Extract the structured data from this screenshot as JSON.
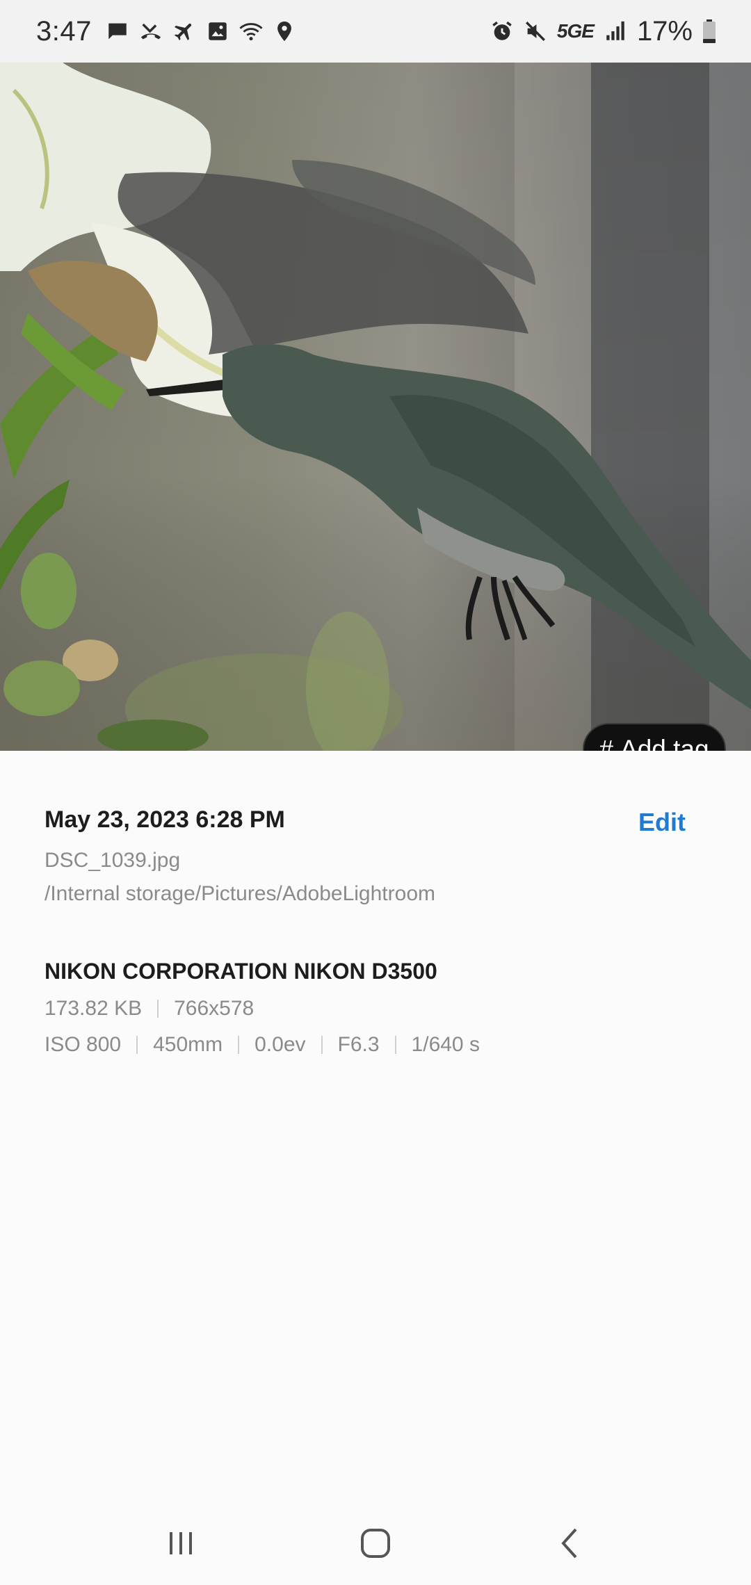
{
  "status_bar": {
    "time": "3:47",
    "network_type": "5GE",
    "battery_level": "17%"
  },
  "photo": {
    "add_tag_hash": "#",
    "add_tag_label": "Add tag"
  },
  "details": {
    "date_time": "May 23, 2023 6:28 PM",
    "edit_label": "Edit",
    "file_name": "DSC_1039.jpg",
    "file_path": "/Internal storage/Pictures/AdobeLightroom",
    "camera": "NIKON CORPORATION NIKON D3500",
    "file_size": "173.82 KB",
    "resolution": "766x578",
    "iso": "ISO 800",
    "focal_length": "450mm",
    "exposure": "0.0ev",
    "aperture": "F6.3",
    "shutter": "1/640 s"
  },
  "colors": {
    "accent": "#1f7ad1",
    "status_bar_bg": "#f2f2f2",
    "page_bg": "#fbfbfb"
  }
}
